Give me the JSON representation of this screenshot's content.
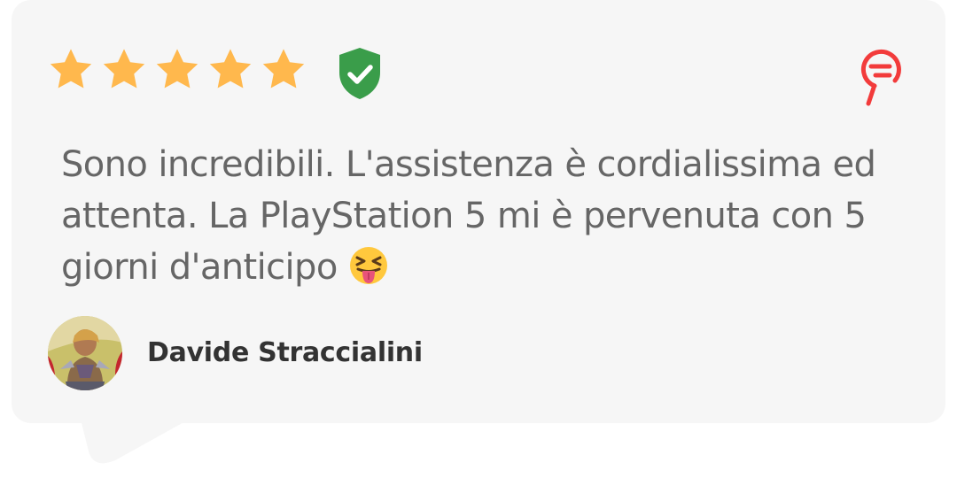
{
  "review": {
    "rating": 5,
    "rating_max": 5,
    "verified_icon": "verified-shield-check-icon",
    "brand_icon": "brand-logo-icon",
    "text": "Sono incredibili. L'assistenza è cordialissima ed attenta. La PlayStation 5 mi è pervenuta con 5 giorni d'anticipo",
    "emoji": "squinting-face-with-tongue",
    "author": "Davide Straccialini",
    "avatar_icon": "user-avatar"
  },
  "colors": {
    "star": "#ffb84d",
    "verified": "#3a9d4a",
    "brand": "#f23b3b",
    "card": "#f6f6f6",
    "text": "#666666",
    "author": "#333333"
  }
}
